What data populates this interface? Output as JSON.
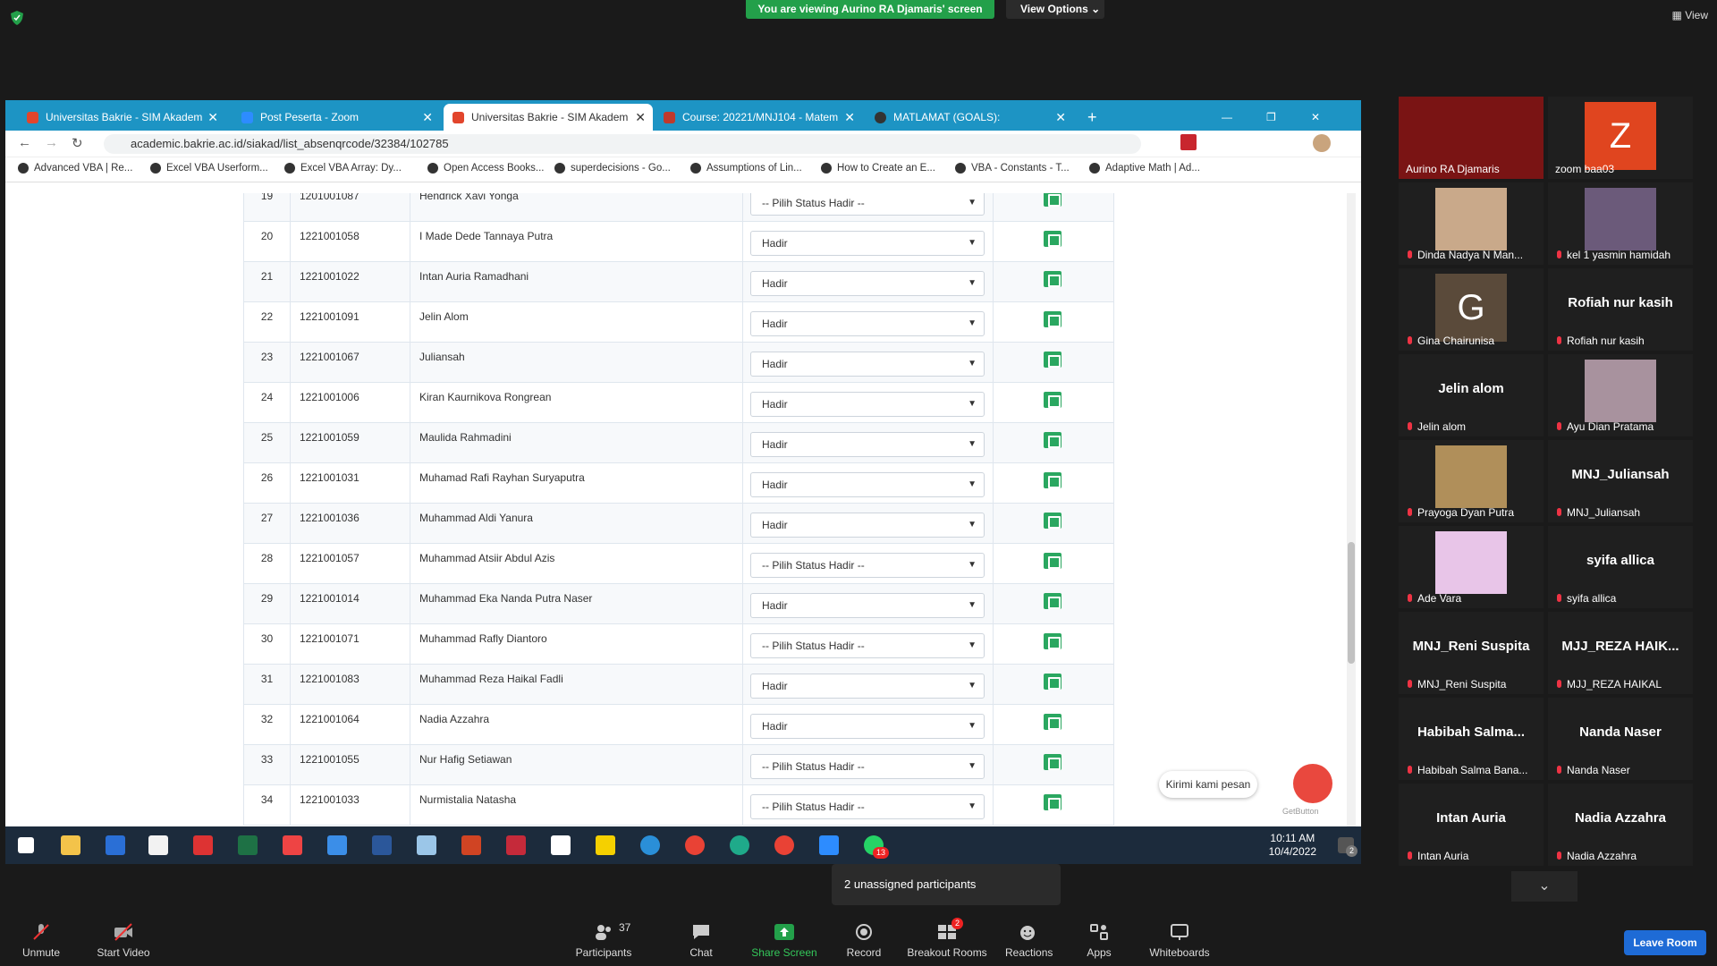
{
  "zoom": {
    "share_banner": "You are viewing Aurino RA Djamaris' screen",
    "view_options": "View Options ⌄",
    "view_label": "View",
    "unassigned": "2 unassigned participants",
    "participants_count": "37",
    "breakout_badge": "2",
    "leave": "Leave Room",
    "toolbar": [
      {
        "label": "Unmute",
        "icon": "mic-muted-icon"
      },
      {
        "label": "Start Video",
        "icon": "video-off-icon"
      },
      {
        "label": "Participants",
        "icon": "participants-icon"
      },
      {
        "label": "Chat",
        "icon": "chat-icon"
      },
      {
        "label": "Share Screen",
        "icon": "share-screen-icon"
      },
      {
        "label": "Record",
        "icon": "record-icon"
      },
      {
        "label": "Breakout Rooms",
        "icon": "breakout-icon"
      },
      {
        "label": "Reactions",
        "icon": "reactions-icon"
      },
      {
        "label": "Apps",
        "icon": "apps-icon"
      },
      {
        "label": "Whiteboards",
        "icon": "whiteboard-icon"
      }
    ]
  },
  "gallery": [
    {
      "name": "Aurino RA Djamaris",
      "kind": "video"
    },
    {
      "name": "zoom baa03",
      "kind": "letter",
      "letter": "Z"
    },
    {
      "name": "Dinda Nadya N Man...",
      "kind": "video"
    },
    {
      "name": "kel 1 yasmin hamidah",
      "kind": "video"
    },
    {
      "name": "Gina Chairunisa",
      "kind": "letter",
      "letter": "G"
    },
    {
      "name": "Rofiah nur kasih",
      "kind": "text",
      "big": "Rofiah nur kasih"
    },
    {
      "name": "Jelin alom",
      "kind": "text",
      "big": "Jelin alom"
    },
    {
      "name": "Ayu Dian Pratama",
      "kind": "video"
    },
    {
      "name": "Prayoga Dyan Putra",
      "kind": "video"
    },
    {
      "name": "MNJ_Juliansah",
      "kind": "text",
      "big": "MNJ_Juliansah"
    },
    {
      "name": "Ade Vara",
      "kind": "video"
    },
    {
      "name": "syifa allica",
      "kind": "text",
      "big": "syifa allica"
    },
    {
      "name": "MNJ_Reni Suspita",
      "kind": "text",
      "big": "MNJ_Reni Suspita"
    },
    {
      "name": "MJJ_REZA HAIKAL",
      "kind": "text",
      "big": "MJJ_REZA  HAIK..."
    },
    {
      "name": "Habibah Salma Bana...",
      "kind": "text",
      "big": "Habibah  Salma..."
    },
    {
      "name": "Nanda Naser",
      "kind": "text",
      "big": "Nanda Naser"
    },
    {
      "name": "Intan Auria",
      "kind": "text",
      "big": "Intan Auria"
    },
    {
      "name": "Nadia Azzahra",
      "kind": "text",
      "big": "Nadia Azzahra"
    }
  ],
  "browser": {
    "tabs": [
      {
        "title": "Universitas Bakrie - SIM Akadem",
        "active": false
      },
      {
        "title": "Post Peserta - Zoom",
        "active": false
      },
      {
        "title": "Universitas Bakrie - SIM Akadem",
        "active": true
      },
      {
        "title": "Course: 20221/MNJ104 - Matem",
        "active": false
      },
      {
        "title": "MATLAMAT (GOALS):",
        "active": false
      }
    ],
    "url": "academic.bakrie.ac.id/siakad/list_absenqrcode/32384/102785",
    "bookmarks": [
      "Advanced VBA | Re...",
      "Excel VBA Userform...",
      "Excel VBA Array: Dy...",
      "Open Access Books...",
      "superdecisions - Go...",
      "Assumptions of Lin...",
      "How to Create an E...",
      "VBA - Constants - T...",
      "Adaptive Math | Ad..."
    ]
  },
  "rows": [
    {
      "no": "19",
      "nim": "1201001087",
      "name": "Hendrick Xavi Yonga",
      "status": "-- Pilih Status Hadir --"
    },
    {
      "no": "20",
      "nim": "1221001058",
      "name": "I Made Dede Tannaya Putra",
      "status": "Hadir"
    },
    {
      "no": "21",
      "nim": "1221001022",
      "name": "Intan Auria Ramadhani",
      "status": "Hadir"
    },
    {
      "no": "22",
      "nim": "1221001091",
      "name": "Jelin Alom",
      "status": "Hadir"
    },
    {
      "no": "23",
      "nim": "1221001067",
      "name": "Juliansah",
      "status": "Hadir"
    },
    {
      "no": "24",
      "nim": "1221001006",
      "name": "Kiran Kaurnikova Rongrean",
      "status": "Hadir"
    },
    {
      "no": "25",
      "nim": "1221001059",
      "name": "Maulida Rahmadini",
      "status": "Hadir"
    },
    {
      "no": "26",
      "nim": "1221001031",
      "name": "Muhamad Rafi Rayhan Suryaputra",
      "status": "Hadir"
    },
    {
      "no": "27",
      "nim": "1221001036",
      "name": "Muhammad Aldi Yanura",
      "status": "Hadir"
    },
    {
      "no": "28",
      "nim": "1221001057",
      "name": "Muhammad Atsiir Abdul Azis",
      "status": "-- Pilih Status Hadir --"
    },
    {
      "no": "29",
      "nim": "1221001014",
      "name": "Muhammad Eka Nanda Putra Naser",
      "status": "Hadir"
    },
    {
      "no": "30",
      "nim": "1221001071",
      "name": "Muhammad Rafly Diantoro",
      "status": "-- Pilih Status Hadir --"
    },
    {
      "no": "31",
      "nim": "1221001083",
      "name": "Muhammad Reza Haikal Fadli",
      "status": "Hadir"
    },
    {
      "no": "32",
      "nim": "1221001064",
      "name": "Nadia Azzahra",
      "status": "Hadir"
    },
    {
      "no": "33",
      "nim": "1221001055",
      "name": "Nur Hafig Setiawan",
      "status": "-- Pilih Status Hadir --"
    },
    {
      "no": "34",
      "nim": "1221001033",
      "name": "Nurmistalia Natasha",
      "status": "-- Pilih Status Hadir --"
    }
  ],
  "chat_widget": {
    "label": "Kirimi kami pesan",
    "brand": "GetButton"
  },
  "taskbar": {
    "time": "10:11 AM",
    "date": "10/4/2022",
    "notif": "2",
    "whatsapp_badge": "13"
  }
}
